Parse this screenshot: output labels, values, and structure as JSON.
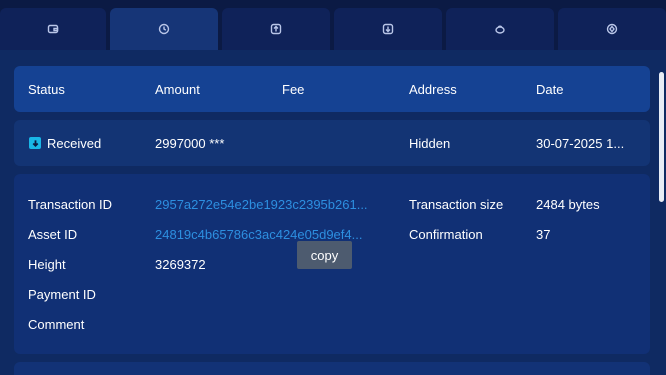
{
  "tabs": [
    {
      "icon": "wallet-icon",
      "active": false
    },
    {
      "icon": "clock-icon",
      "active": true
    },
    {
      "icon": "upload-icon",
      "active": false
    },
    {
      "icon": "download-icon",
      "active": false
    },
    {
      "icon": "piggy-bank-icon",
      "active": false
    },
    {
      "icon": "coin-icon",
      "active": false
    }
  ],
  "table": {
    "columns": [
      "Status",
      "Amount",
      "Fee",
      "Address",
      "Date"
    ]
  },
  "transaction": {
    "status": "Received",
    "amount": "2997000 ***",
    "fee": "",
    "address": "Hidden",
    "date": "30-07-2025 1..."
  },
  "details": {
    "tx_id_label": "Transaction ID",
    "tx_id_value": "2957a272e54e2be1923c2395b261...",
    "asset_id_label": "Asset ID",
    "asset_id_value": "24819c4b65786c3ac424e05d9ef4...",
    "height_label": "Height",
    "height_value": "3269372",
    "payment_id_label": "Payment ID",
    "comment_label": "Comment",
    "tx_size_label": "Transaction size",
    "tx_size_value": "2484 bytes",
    "confirmation_label": "Confirmation",
    "confirmation_value": "37"
  },
  "tooltip": {
    "copy_label": "copy"
  },
  "colors": {
    "background": "#0d1f4e",
    "header_row": "#154293",
    "link": "#2d8fe0",
    "status_icon": "#19b6e6"
  }
}
